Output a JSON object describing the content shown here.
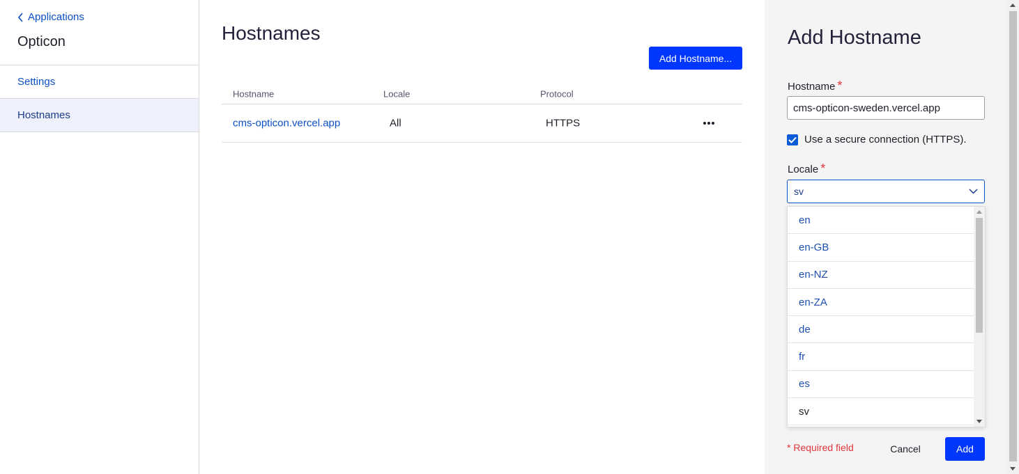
{
  "sidebar": {
    "back_label": "Applications",
    "app_name": "Opticon",
    "items": [
      {
        "label": "Settings",
        "active": false
      },
      {
        "label": "Hostnames",
        "active": true
      }
    ]
  },
  "main": {
    "title": "Hostnames",
    "add_button_label": "Add Hostname...",
    "table": {
      "columns": [
        "Hostname",
        "Locale",
        "Protocol"
      ],
      "rows": [
        {
          "hostname": "cms-opticon.vercel.app",
          "locale": "All",
          "protocol": "HTTPS"
        }
      ]
    }
  },
  "panel": {
    "title": "Add Hostname",
    "hostname_label": "Hostname",
    "required_marker": "*",
    "hostname_value": "cms-opticon-sweden.vercel.app",
    "https_checked": true,
    "https_label": "Use a secure connection (HTTPS).",
    "locale_label": "Locale",
    "locale_value": "sv",
    "locale_options": [
      "en",
      "en-GB",
      "en-NZ",
      "en-ZA",
      "de",
      "fr",
      "es",
      "sv"
    ],
    "required_note": "* Required field",
    "cancel_label": "Cancel",
    "add_label": "Add"
  },
  "colors": {
    "primary_button": "#0037ff",
    "link": "#0b4fc6",
    "required": "#e0353b",
    "active_nav_bg": "#eef1fb",
    "panel_bg": "#f4f4f5"
  }
}
